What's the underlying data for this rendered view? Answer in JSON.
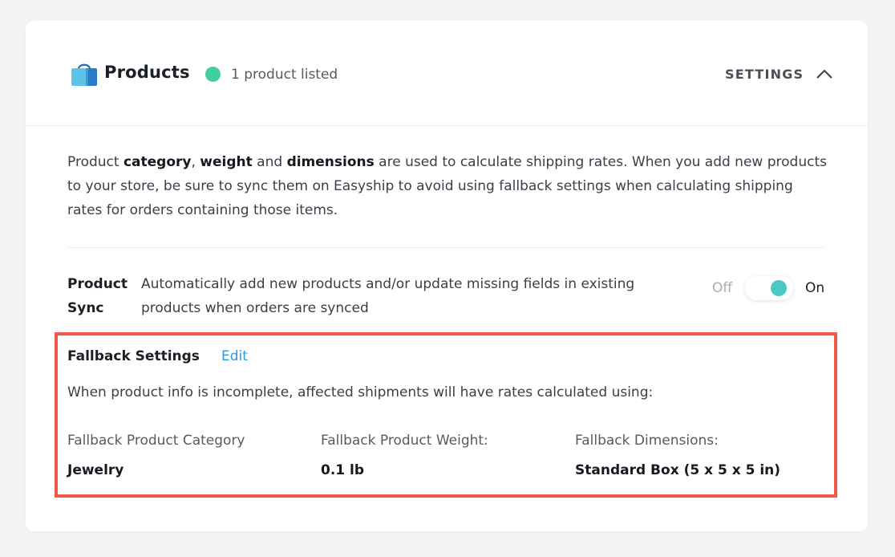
{
  "header": {
    "title": "Products",
    "status_text": "1 product listed",
    "status_color": "#43cea1",
    "settings_label": "SETTINGS",
    "icons": [
      "shopping-bag-icon",
      "chevron-up-icon"
    ]
  },
  "intro": {
    "segments": [
      {
        "text": "Product ",
        "bold": false
      },
      {
        "text": "category",
        "bold": true
      },
      {
        "text": ", ",
        "bold": false
      },
      {
        "text": "weight",
        "bold": true
      },
      {
        "text": " and ",
        "bold": false
      },
      {
        "text": "dimensions",
        "bold": true
      },
      {
        "text": " are used to calculate shipping rates. When you add new products to your store, be sure to sync them on Easyship to avoid using fallback settings when calculating shipping rates for orders containing those items.",
        "bold": false
      }
    ]
  },
  "product_sync": {
    "title": "Product Sync",
    "description": "Automatically add new products and/or update missing fields in existing products when orders are synced",
    "toggle_off_label": "Off",
    "toggle_on_label": "On",
    "toggle_state": "on",
    "toggle_color": "#48c9c5"
  },
  "fallback": {
    "title": "Fallback Settings",
    "edit_label": "Edit",
    "description": "When product info is incomplete, affected shipments will have rates calculated using:",
    "highlight_color": "#f2594b",
    "columns": [
      {
        "label": "Fallback Product Category",
        "value": "Jewelry"
      },
      {
        "label": "Fallback Product Weight:",
        "value": "0.1 lb"
      },
      {
        "label": "Fallback Dimensions:",
        "value": "Standard Box (5 x 5 x 5 in)"
      }
    ]
  }
}
